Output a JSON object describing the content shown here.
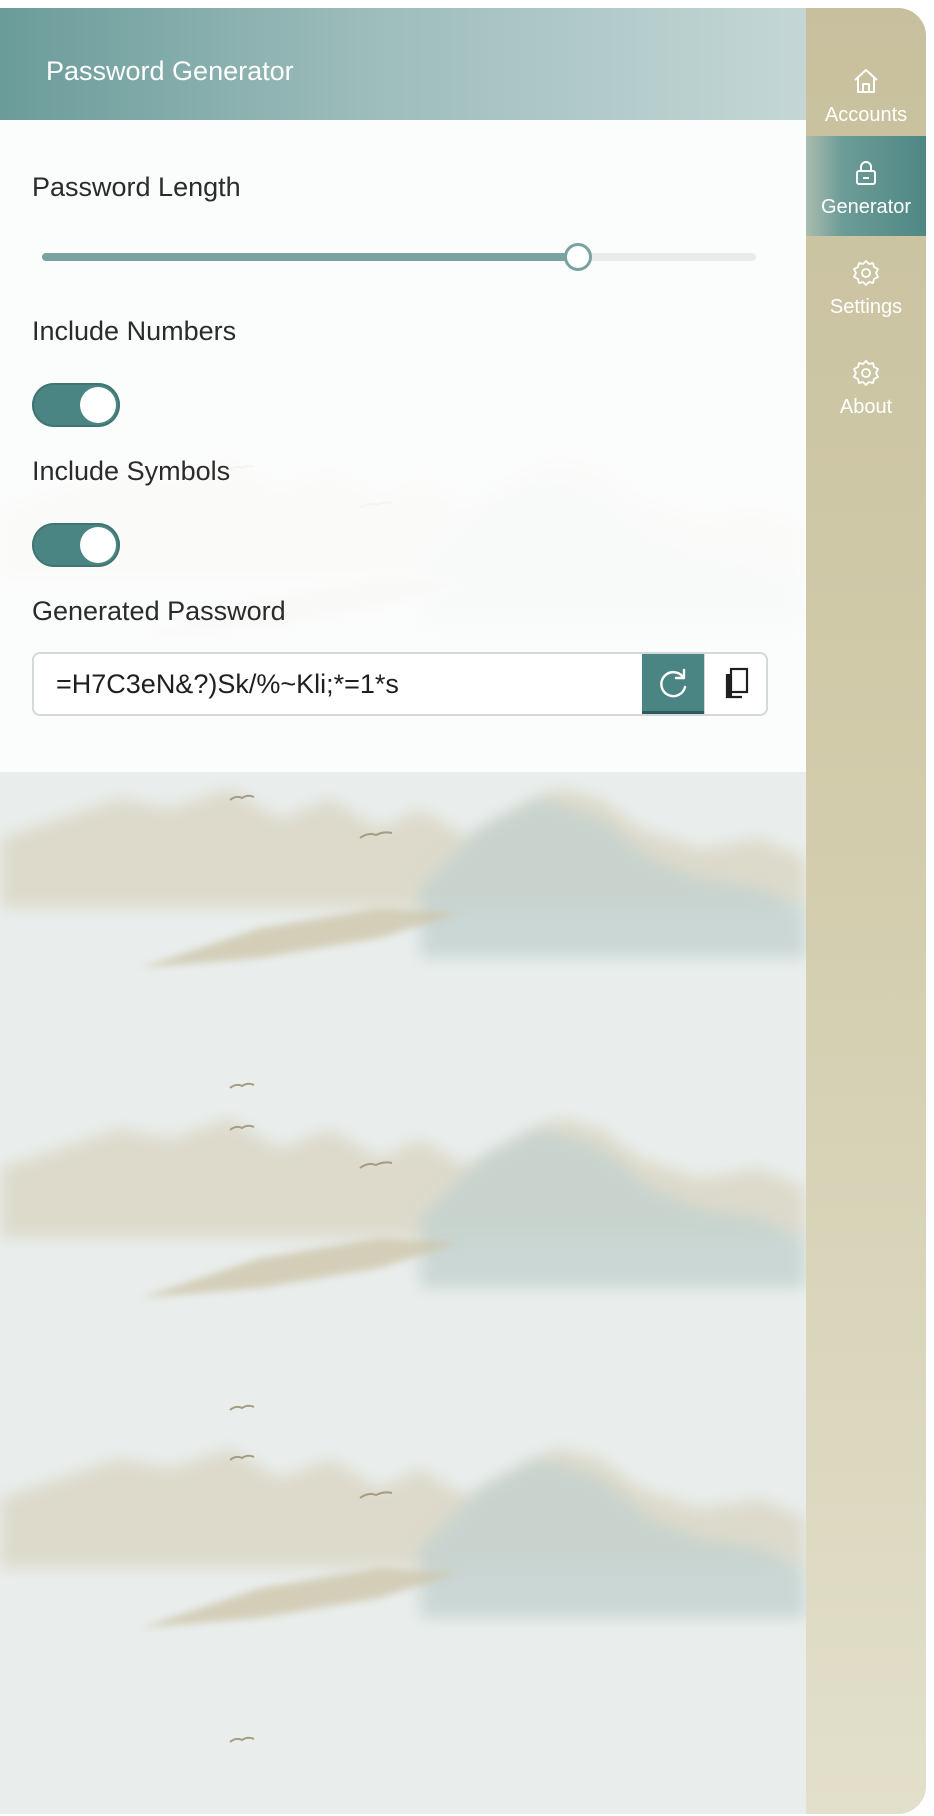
{
  "header": {
    "title": "Password Generator"
  },
  "generator": {
    "length_label": "Password Length",
    "length_fraction": 0.75,
    "numbers_label": "Include Numbers",
    "numbers_enabled": true,
    "symbols_label": "Include Symbols",
    "symbols_enabled": true,
    "output_label": "Generated Password",
    "password": "=H7C3eN&?)Sk/%~Kli;*=1*s",
    "refresh_icon": "refresh-icon",
    "copy_icon": "copy-icon"
  },
  "sidebar": {
    "items": [
      {
        "label": "Accounts",
        "icon": "home-icon",
        "active": false
      },
      {
        "label": "Generator",
        "icon": "lock-icon",
        "active": true
      },
      {
        "label": "Settings",
        "icon": "gear-icon",
        "active": false
      },
      {
        "label": "About",
        "icon": "gear-icon",
        "active": false
      }
    ]
  },
  "colors": {
    "accent": "#4b8583",
    "header_start": "#6a9c9a",
    "sidebar": "#c8c09d"
  }
}
